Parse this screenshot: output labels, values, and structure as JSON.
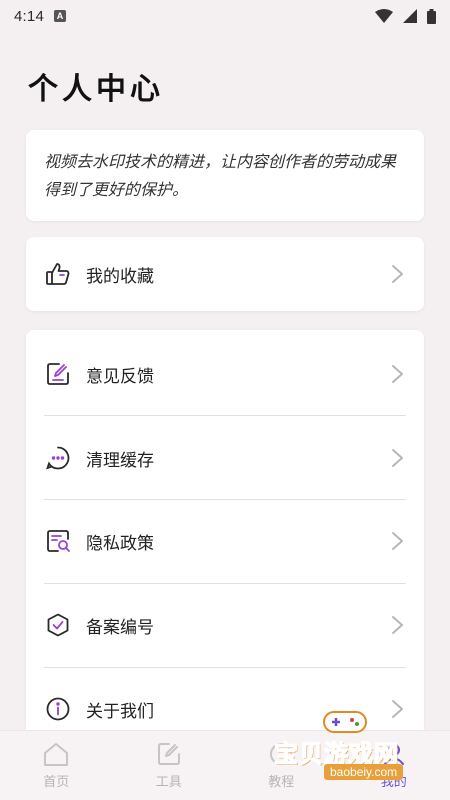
{
  "status_bar": {
    "time": "4:14",
    "notification_icon": "A"
  },
  "page": {
    "title": "个人中心"
  },
  "intro": {
    "text": "视频去水印技术的精进，让内容创作者的劳动成果得到了更好的保护。"
  },
  "favorites": {
    "label": "我的收藏",
    "icon": "thumbs-up-icon"
  },
  "menu": {
    "items": [
      {
        "label": "意见反馈",
        "icon": "edit-square-icon"
      },
      {
        "label": "清理缓存",
        "icon": "chat-dots-icon"
      },
      {
        "label": "隐私政策",
        "icon": "document-search-icon"
      },
      {
        "label": "备案编号",
        "icon": "shield-check-icon"
      },
      {
        "label": "关于我们",
        "icon": "info-icon"
      }
    ]
  },
  "tabbar": {
    "tabs": [
      {
        "label": "首页",
        "icon": "home-icon"
      },
      {
        "label": "工具",
        "icon": "edit-icon"
      },
      {
        "label": "教程",
        "icon": "book-icon"
      },
      {
        "label": "我的",
        "icon": "user-icon"
      }
    ]
  },
  "watermark": {
    "text": "宝贝游戏网",
    "url": "baobeiy.com"
  },
  "colors": {
    "accent": "#6b4fd8",
    "background": "#f4f0f1",
    "card": "#ffffff"
  }
}
